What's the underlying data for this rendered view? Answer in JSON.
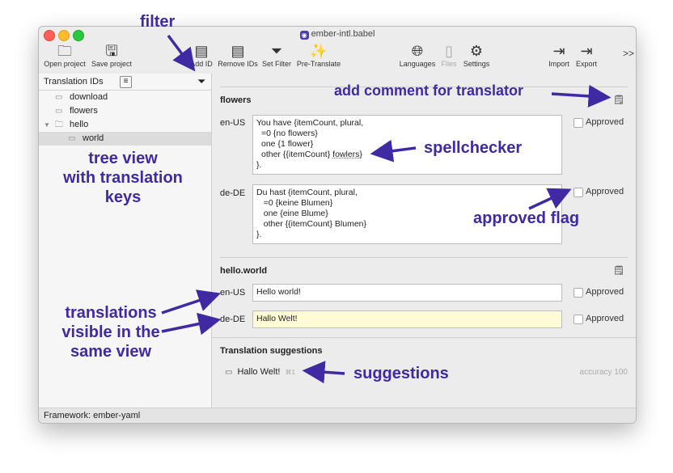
{
  "window": {
    "title": "ember-intl.babel"
  },
  "toolbar": {
    "open_project": "Open project",
    "save_project": "Save project",
    "add_id": "Add ID",
    "remove_ids": "Remove IDs",
    "set_filter": "Set Filter",
    "pre_translate": "Pre-Translate",
    "languages": "Languages",
    "files": "Files",
    "settings": "Settings",
    "import": "Import",
    "export": "Export",
    "more": ">>"
  },
  "sidebar": {
    "header": "Translation IDs",
    "items": [
      {
        "label": "download"
      },
      {
        "label": "flowers"
      },
      {
        "label": "hello"
      },
      {
        "label": "world"
      }
    ]
  },
  "entries": {
    "flowers": {
      "key": "flowers",
      "en": {
        "locale": "en-US",
        "line1": "You have {itemCount, plural,",
        "line2": "=0 {no flowers}",
        "line3": "one {1 flower}",
        "line4a": "other {{itemCount} ",
        "line4b": "fowlers",
        "line4c": "}",
        "line5": "}."
      },
      "de": {
        "locale": "de-DE",
        "text": "Du hast {itemCount, plural,\n   =0 {keine Blumen}\n   one {eine Blume}\n   other {{itemCount} Blumen}\n}."
      },
      "approved": "Approved"
    },
    "hello_world": {
      "key": "hello.world",
      "en": {
        "locale": "en-US",
        "text": "Hello world!"
      },
      "de": {
        "locale": "de-DE",
        "text": "Hallo Welt!"
      },
      "approved": "Approved"
    }
  },
  "suggestions": {
    "title": "Translation suggestions",
    "items": [
      {
        "text": "Hallo Welt!",
        "shortcut": "⌘1",
        "accuracy": "accuracy 100"
      }
    ]
  },
  "status": {
    "framework": "Framework: ember-yaml"
  },
  "annotations": {
    "filter": "filter",
    "add_comment": "add comment for translator",
    "spellchecker": "spellchecker",
    "approved_flag": "approved flag",
    "tree_view": "tree view\nwith translation\nkeys",
    "translations": "translations\nvisible in the\nsame view",
    "suggestions": "suggestions"
  },
  "colors": {
    "annotation": "#3f2aa3",
    "highlight": "#fffbd6"
  }
}
